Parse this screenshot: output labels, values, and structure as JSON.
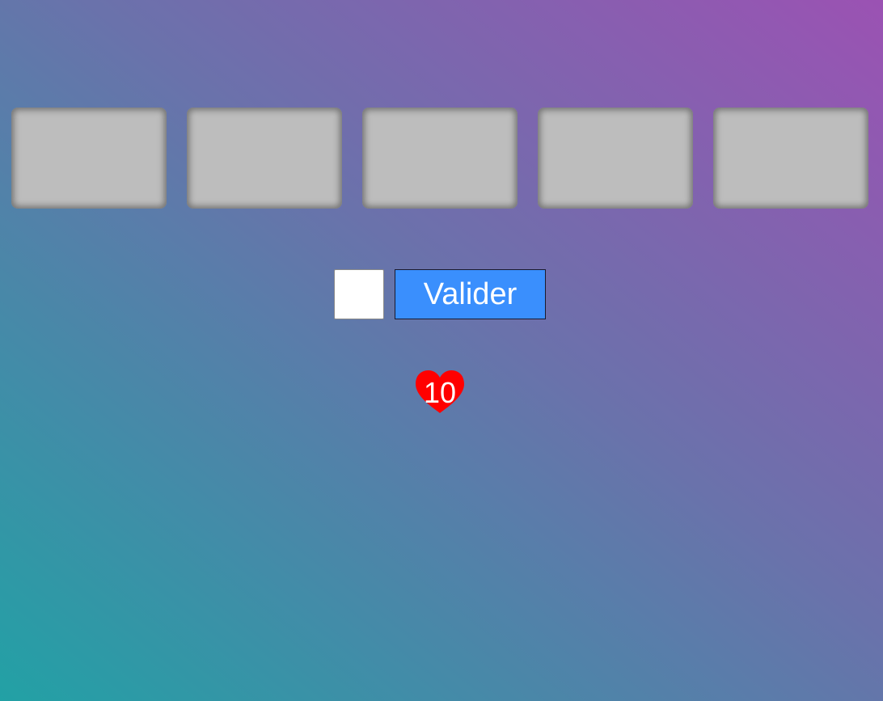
{
  "word_slots": {
    "count": 5,
    "slot_color": "#bdbdbd"
  },
  "guess": {
    "input_value": "",
    "button_label": "Valider",
    "button_color": "#3a8ffd"
  },
  "lives": {
    "count": "10",
    "icon": "heart-icon",
    "icon_color": "#ff0000"
  }
}
